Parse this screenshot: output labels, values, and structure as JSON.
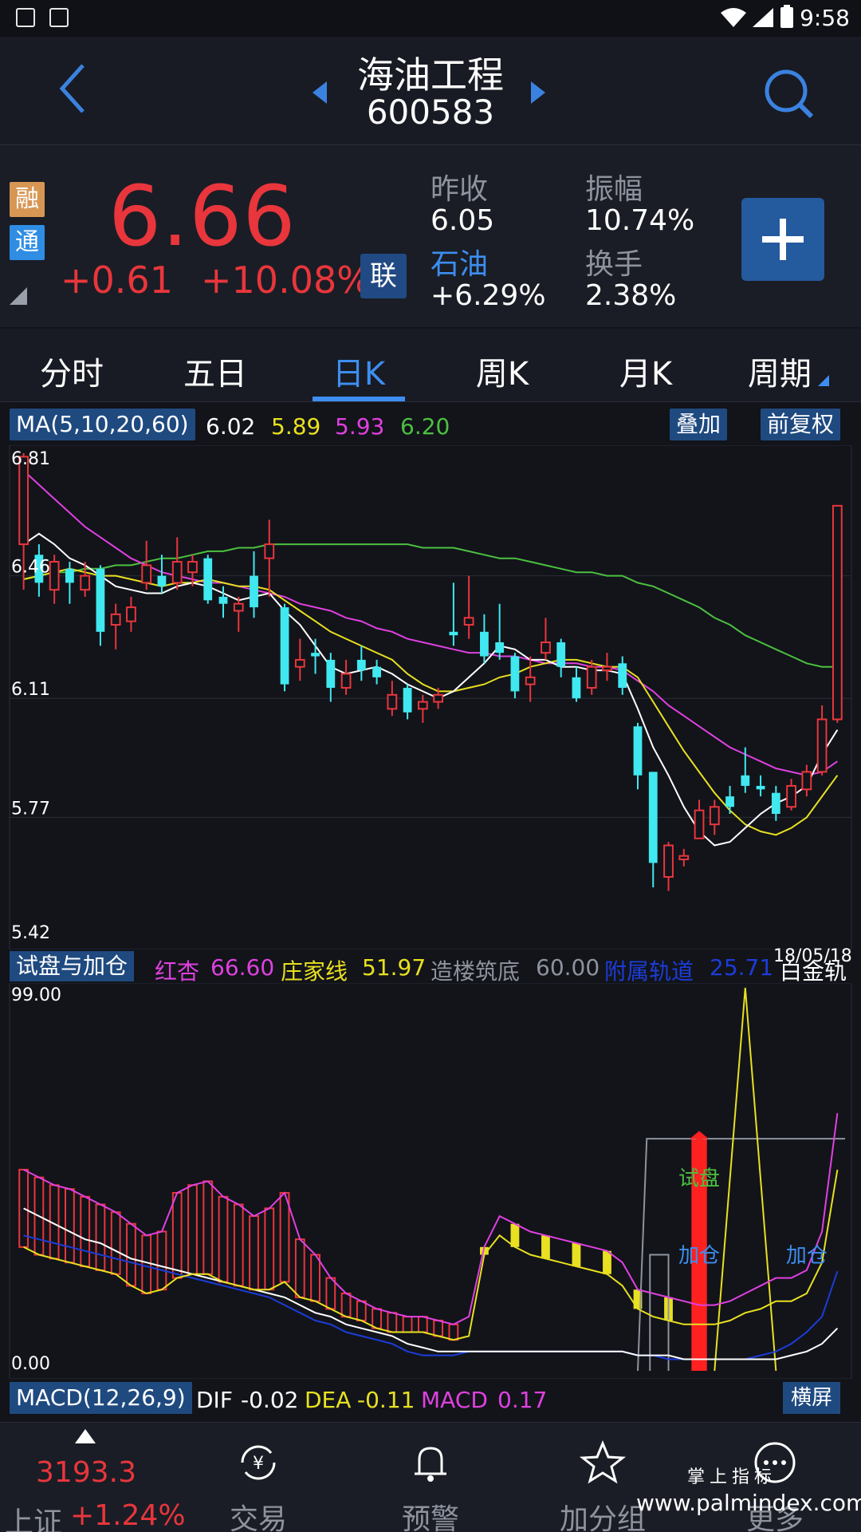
{
  "status_bar": {
    "time": "9:58"
  },
  "header": {
    "title": "海油工程",
    "code": "600583"
  },
  "quote": {
    "tags": [
      "融",
      "通"
    ],
    "price": "6.66",
    "change": "+0.61",
    "change_pct": "+10.08%",
    "lian": "联",
    "prev_close_label": "昨收",
    "prev_close": "6.05",
    "amplitude_label": "振幅",
    "amplitude": "10.74%",
    "sector_label": "石油",
    "sector_change": "+6.29%",
    "turnover_label": "换手",
    "turnover": "2.38%",
    "price_color": "#e8363c"
  },
  "tabs": [
    {
      "label": "分时"
    },
    {
      "label": "五日"
    },
    {
      "label": "日K"
    },
    {
      "label": "周K"
    },
    {
      "label": "月K"
    },
    {
      "label": "周期"
    }
  ],
  "active_tab": "日K",
  "ma_bar": {
    "label": "MA(5,10,20,60)",
    "values": [
      {
        "value": "6.02",
        "color": "#ffffff"
      },
      {
        "value": "5.89",
        "color": "#e8e020"
      },
      {
        "value": "5.93",
        "color": "#e040e0"
      },
      {
        "value": "6.20",
        "color": "#4cc040"
      }
    ],
    "btn_overlay": "叠加",
    "btn_adjust": "前复权"
  },
  "main_axis": {
    "ticks": [
      "6.81",
      "6.46",
      "6.11",
      "5.77",
      "5.42"
    ]
  },
  "date_label": "18/05/18",
  "sub_bar": {
    "label": "试盘与加仓",
    "items": [
      {
        "name": "红杏",
        "value": "66.60",
        "color": "#e040e0"
      },
      {
        "name": "庄家线",
        "value": "51.97",
        "color": "#e8e020"
      },
      {
        "name": "造楼筑底",
        "value": "60.00",
        "color": "#8e939e"
      },
      {
        "name": "附属轨道",
        "value": "25.71",
        "color": "#1c3cd8"
      }
    ],
    "trailing": "白金轨"
  },
  "sub_axis": {
    "top": "99.00",
    "bottom": "0.00"
  },
  "sub_annotations": {
    "test": "试盘",
    "add1": "加仓",
    "add2": "加仓"
  },
  "macd_bar": {
    "label": "MACD(12,26,9)",
    "dif_name": "DIF",
    "dif": "-0.02",
    "dea_name": "DEA",
    "dea": "-0.11",
    "macd_name": "MACD",
    "macd": "0.17",
    "btn_landscape": "横屏"
  },
  "nav": {
    "index_value": "3193.3",
    "index_name": "上证",
    "index_pct": "+1.24%",
    "items": [
      "交易",
      "预警",
      "加分组",
      "更多"
    ],
    "watermark_cn": "掌上指标",
    "watermark_url": "www.palmindex.com"
  },
  "chart_data": {
    "type": "candlestick",
    "ylim": [
      5.42,
      6.81
    ],
    "candles": [
      {
        "o": 6.55,
        "c": 6.8,
        "h": 6.81,
        "l": 6.42
      },
      {
        "o": 6.52,
        "c": 6.44,
        "h": 6.55,
        "l": 6.4
      },
      {
        "o": 6.42,
        "c": 6.5,
        "h": 6.52,
        "l": 6.38
      },
      {
        "o": 6.48,
        "c": 6.44,
        "h": 6.5,
        "l": 6.38
      },
      {
        "o": 6.42,
        "c": 6.46,
        "h": 6.5,
        "l": 6.4
      },
      {
        "o": 6.48,
        "c": 6.3,
        "h": 6.49,
        "l": 6.26
      },
      {
        "o": 6.32,
        "c": 6.35,
        "h": 6.38,
        "l": 6.25
      },
      {
        "o": 6.33,
        "c": 6.37,
        "h": 6.4,
        "l": 6.3
      },
      {
        "o": 6.44,
        "c": 6.49,
        "h": 6.56,
        "l": 6.42
      },
      {
        "o": 6.46,
        "c": 6.43,
        "h": 6.52,
        "l": 6.41
      },
      {
        "o": 6.44,
        "c": 6.5,
        "h": 6.57,
        "l": 6.42
      },
      {
        "o": 6.47,
        "c": 6.5,
        "h": 6.52,
        "l": 6.43
      },
      {
        "o": 6.51,
        "c": 6.39,
        "h": 6.52,
        "l": 6.38
      },
      {
        "o": 6.4,
        "c": 6.38,
        "h": 6.43,
        "l": 6.34
      },
      {
        "o": 6.36,
        "c": 6.38,
        "h": 6.4,
        "l": 6.3
      },
      {
        "o": 6.46,
        "c": 6.37,
        "h": 6.53,
        "l": 6.34
      },
      {
        "o": 6.51,
        "c": 6.55,
        "h": 6.62,
        "l": 6.4
      },
      {
        "o": 6.37,
        "c": 6.15,
        "h": 6.38,
        "l": 6.13
      },
      {
        "o": 6.2,
        "c": 6.22,
        "h": 6.28,
        "l": 6.16
      },
      {
        "o": 6.24,
        "c": 6.23,
        "h": 6.28,
        "l": 6.18
      },
      {
        "o": 6.22,
        "c": 6.14,
        "h": 6.24,
        "l": 6.1
      },
      {
        "o": 6.14,
        "c": 6.18,
        "h": 6.22,
        "l": 6.12
      },
      {
        "o": 6.22,
        "c": 6.19,
        "h": 6.26,
        "l": 6.16
      },
      {
        "o": 6.2,
        "c": 6.17,
        "h": 6.22,
        "l": 6.15
      },
      {
        "o": 6.08,
        "c": 6.12,
        "h": 6.16,
        "l": 6.06
      },
      {
        "o": 6.14,
        "c": 6.07,
        "h": 6.15,
        "l": 6.05
      },
      {
        "o": 6.08,
        "c": 6.1,
        "h": 6.12,
        "l": 6.04
      },
      {
        "o": 6.1,
        "c": 6.12,
        "h": 6.14,
        "l": 6.08
      },
      {
        "o": 6.3,
        "c": 6.29,
        "h": 6.44,
        "l": 6.26
      },
      {
        "o": 6.32,
        "c": 6.34,
        "h": 6.46,
        "l": 6.28
      },
      {
        "o": 6.3,
        "c": 6.23,
        "h": 6.35,
        "l": 6.21
      },
      {
        "o": 6.27,
        "c": 6.24,
        "h": 6.38,
        "l": 6.22
      },
      {
        "o": 6.23,
        "c": 6.13,
        "h": 6.24,
        "l": 6.11
      },
      {
        "o": 6.15,
        "c": 6.17,
        "h": 6.23,
        "l": 6.1
      },
      {
        "o": 6.24,
        "c": 6.27,
        "h": 6.34,
        "l": 6.22
      },
      {
        "o": 6.27,
        "c": 6.2,
        "h": 6.28,
        "l": 6.17
      },
      {
        "o": 6.17,
        "c": 6.11,
        "h": 6.2,
        "l": 6.1
      },
      {
        "o": 6.14,
        "c": 6.2,
        "h": 6.22,
        "l": 6.12
      },
      {
        "o": 6.19,
        "c": 6.2,
        "h": 6.24,
        "l": 6.16
      },
      {
        "o": 6.21,
        "c": 6.14,
        "h": 6.23,
        "l": 6.12
      },
      {
        "o": 6.03,
        "c": 5.89,
        "h": 6.04,
        "l": 5.85
      },
      {
        "o": 5.9,
        "c": 5.64,
        "h": 5.9,
        "l": 5.57
      },
      {
        "o": 5.6,
        "c": 5.69,
        "h": 5.7,
        "l": 5.56
      },
      {
        "o": 5.65,
        "c": 5.66,
        "h": 5.68,
        "l": 5.63
      },
      {
        "o": 5.71,
        "c": 5.79,
        "h": 5.82,
        "l": 5.71
      },
      {
        "o": 5.75,
        "c": 5.8,
        "h": 5.82,
        "l": 5.72
      },
      {
        "o": 5.83,
        "c": 5.8,
        "h": 5.86,
        "l": 5.78
      },
      {
        "o": 5.89,
        "c": 5.86,
        "h": 5.97,
        "l": 5.84
      },
      {
        "o": 5.86,
        "c": 5.85,
        "h": 5.89,
        "l": 5.83
      },
      {
        "o": 5.84,
        "c": 5.78,
        "h": 5.86,
        "l": 5.76
      },
      {
        "o": 5.8,
        "c": 5.86,
        "h": 5.88,
        "l": 5.79
      },
      {
        "o": 5.85,
        "c": 5.9,
        "h": 5.92,
        "l": 5.83
      },
      {
        "o": 5.9,
        "c": 6.05,
        "h": 6.09,
        "l": 5.89
      },
      {
        "o": 6.05,
        "c": 6.66,
        "h": 6.66,
        "l": 6.04
      }
    ],
    "ma5": [
      6.55,
      6.58,
      6.55,
      6.51,
      6.49,
      6.46,
      6.43,
      6.42,
      6.41,
      6.41,
      6.43,
      6.44,
      6.43,
      6.41,
      6.39,
      6.4,
      6.41,
      6.36,
      6.32,
      6.26,
      6.2,
      6.18,
      6.19,
      6.2,
      6.18,
      6.15,
      6.13,
      6.11,
      6.13,
      6.17,
      6.21,
      6.26,
      6.25,
      6.22,
      6.22,
      6.2,
      6.2,
      6.19,
      6.19,
      6.18,
      6.08,
      5.97,
      5.89,
      5.8,
      5.73,
      5.69,
      5.7,
      5.74,
      5.78,
      5.81,
      5.83,
      5.86,
      5.95,
      6.02
    ],
    "ma10": [
      6.45,
      6.46,
      6.47,
      6.48,
      6.47,
      6.46,
      6.46,
      6.45,
      6.44,
      6.43,
      6.44,
      6.44,
      6.45,
      6.44,
      6.43,
      6.43,
      6.42,
      6.39,
      6.36,
      6.33,
      6.3,
      6.28,
      6.26,
      6.24,
      6.22,
      6.18,
      6.15,
      6.13,
      6.13,
      6.14,
      6.15,
      6.17,
      6.18,
      6.2,
      6.21,
      6.22,
      6.22,
      6.21,
      6.2,
      6.2,
      6.17,
      6.1,
      6.03,
      5.96,
      5.9,
      5.84,
      5.79,
      5.75,
      5.73,
      5.72,
      5.74,
      5.77,
      5.83,
      5.89
    ],
    "ma20": [
      6.76,
      6.72,
      6.68,
      6.64,
      6.6,
      6.57,
      6.54,
      6.51,
      6.49,
      6.47,
      6.46,
      6.45,
      6.44,
      6.44,
      6.43,
      6.42,
      6.41,
      6.4,
      6.38,
      6.37,
      6.36,
      6.34,
      6.33,
      6.31,
      6.3,
      6.28,
      6.27,
      6.26,
      6.25,
      6.24,
      6.24,
      6.23,
      6.23,
      6.22,
      6.21,
      6.21,
      6.21,
      6.2,
      6.2,
      6.19,
      6.16,
      6.13,
      6.09,
      6.06,
      6.03,
      6.0,
      5.97,
      5.95,
      5.93,
      5.91,
      5.9,
      5.89,
      5.9,
      5.93
    ],
    "ma60": [
      6.45,
      6.46,
      6.47,
      6.47,
      6.48,
      6.48,
      6.49,
      6.49,
      6.5,
      6.51,
      6.51,
      6.52,
      6.53,
      6.53,
      6.54,
      6.54,
      6.55,
      6.55,
      6.55,
      6.55,
      6.55,
      6.55,
      6.55,
      6.55,
      6.55,
      6.55,
      6.54,
      6.54,
      6.54,
      6.53,
      6.52,
      6.51,
      6.51,
      6.5,
      6.49,
      6.48,
      6.47,
      6.47,
      6.46,
      6.46,
      6.44,
      6.43,
      6.41,
      6.39,
      6.37,
      6.34,
      6.32,
      6.29,
      6.27,
      6.25,
      6.23,
      6.21,
      6.2,
      6.2
    ],
    "sub_ylim": [
      0,
      99
    ],
    "hongxing": [
      52,
      50,
      48,
      47,
      45,
      43,
      41,
      38,
      35,
      36,
      46,
      48,
      49,
      45,
      43,
      40,
      42,
      46,
      34,
      30,
      24,
      20,
      18,
      16,
      15,
      14,
      14,
      13,
      12,
      14,
      32,
      40,
      38,
      36,
      35,
      34,
      33,
      32,
      31,
      28,
      21,
      20,
      19,
      18,
      17,
      17,
      18,
      20,
      22,
      24,
      24,
      26,
      36,
      66.6
    ],
    "zhuangjia": [
      32,
      30,
      29,
      28,
      27,
      26,
      25,
      22,
      20,
      21,
      24,
      25,
      25,
      23,
      22,
      21,
      21,
      23,
      19,
      18,
      16,
      14,
      13,
      11,
      10,
      10,
      10,
      9,
      8,
      9,
      30,
      35,
      32,
      30,
      29,
      28,
      27,
      26,
      25,
      22,
      16,
      14,
      13,
      12,
      12,
      12,
      13,
      15,
      16,
      18,
      18,
      20,
      28,
      51.97
    ],
    "baijin": [
      42,
      40,
      38,
      36,
      34,
      33,
      31,
      29,
      28,
      27,
      26,
      25,
      24,
      23,
      22,
      21,
      20,
      19,
      17,
      15,
      14,
      12,
      11,
      10,
      9,
      7,
      6,
      5,
      5,
      5,
      5,
      5,
      5,
      5,
      5,
      5,
      5,
      5,
      5,
      5,
      4,
      4,
      4,
      3,
      3,
      3,
      3,
      3,
      3,
      3,
      4,
      5,
      7,
      11
    ],
    "fushu": [
      35,
      34,
      33,
      32,
      31,
      30,
      29,
      28,
      27,
      26,
      25,
      24,
      23,
      22,
      21,
      20,
      19,
      17,
      15,
      13,
      12,
      10,
      9,
      8,
      7,
      5,
      4,
      4,
      4,
      5,
      5,
      5,
      5,
      5,
      5,
      5,
      5,
      5,
      5,
      5,
      4,
      4,
      3,
      3,
      3,
      3,
      3,
      3,
      4,
      5,
      7,
      10,
      14,
      25.71
    ],
    "zaolou_flag": [
      0,
      0,
      0,
      0,
      0,
      0,
      0,
      0,
      0,
      0,
      0,
      0,
      0,
      0,
      0,
      0,
      0,
      0,
      0,
      0,
      0,
      0,
      0,
      0,
      0,
      0,
      0,
      0,
      0,
      0,
      0,
      0,
      0,
      0,
      0,
      0,
      0,
      0,
      0,
      0,
      0,
      0,
      0,
      0,
      0,
      0,
      0,
      0,
      0,
      0,
      0,
      0,
      0,
      60
    ]
  }
}
